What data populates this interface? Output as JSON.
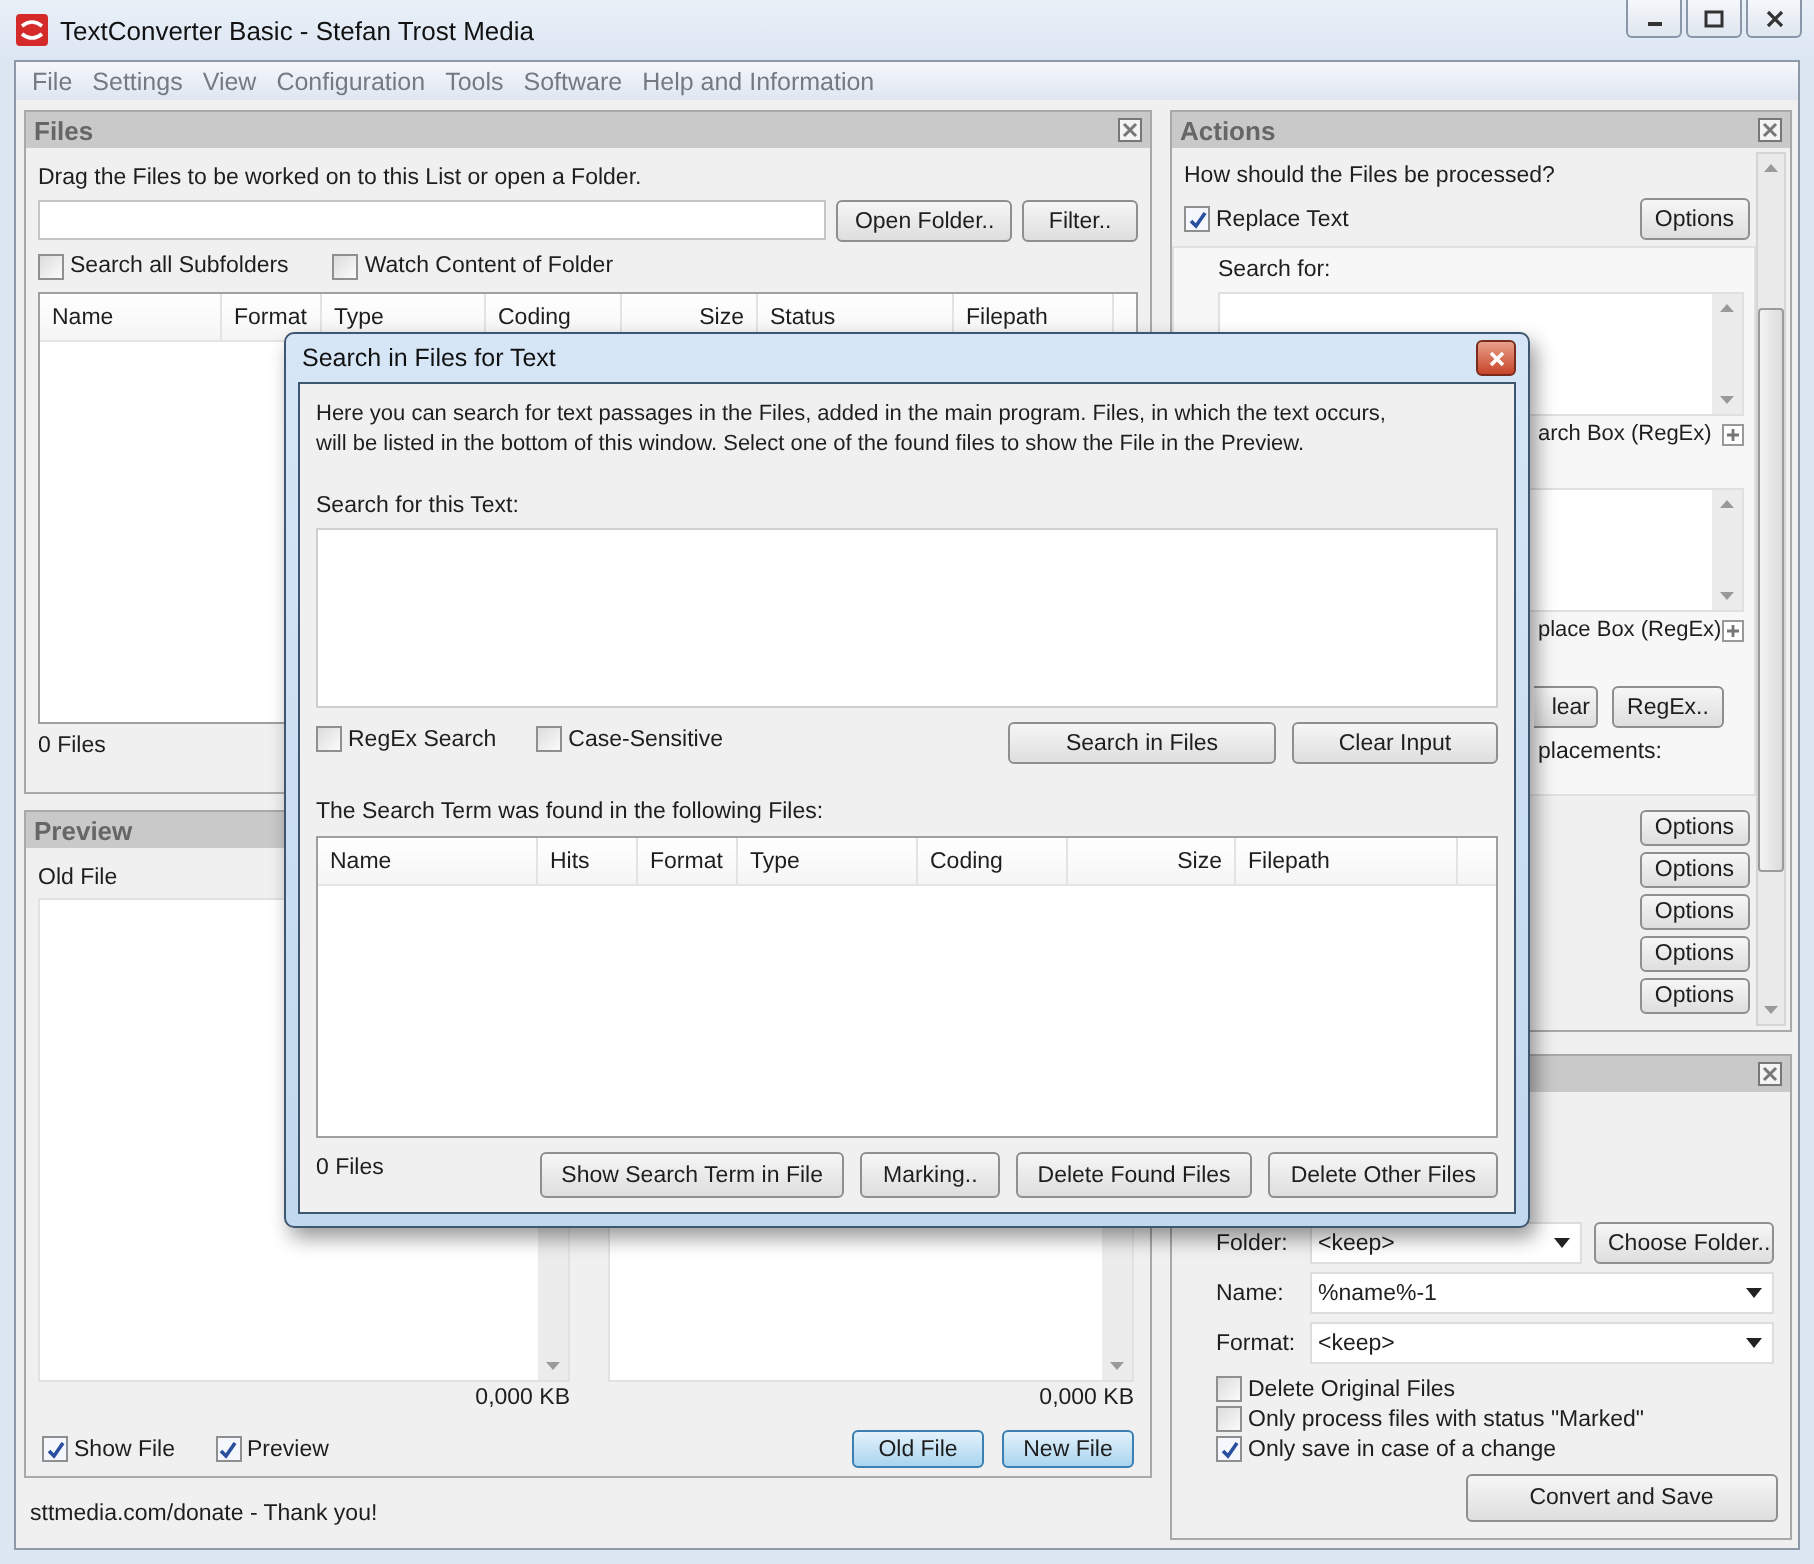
{
  "window": {
    "title": "TextConverter Basic - Stefan Trost Media"
  },
  "menu": [
    "File",
    "Settings",
    "View",
    "Configuration",
    "Tools",
    "Software",
    "Help and Information"
  ],
  "files_panel": {
    "title": "Files",
    "hint": "Drag the Files to be worked on to this List or open a Folder.",
    "buttons": [
      "Open Folder..",
      "Filter.."
    ],
    "options": [
      {
        "label": "Search all Subfolders",
        "checked": false
      },
      {
        "label": "Watch Content of Folder",
        "checked": false
      }
    ],
    "columns": [
      "Name",
      "Format",
      "Type",
      "Coding",
      "Size",
      "Status",
      "Filepath"
    ],
    "count": "0 Files"
  },
  "preview_panel": {
    "title": "Preview",
    "old_label": "Old File",
    "sizes": [
      "0,000 KB",
      "0,000 KB"
    ],
    "options": [
      {
        "label": "Show File",
        "checked": true
      },
      {
        "label": "Preview",
        "checked": true
      }
    ],
    "buttons": [
      "Old File",
      "New File"
    ]
  },
  "status_bar": "sttmedia.com/donate - Thank you!",
  "actions_panel": {
    "title": "Actions",
    "question": "How should the Files be processed?",
    "replace": {
      "label": "Replace Text",
      "checked": true
    },
    "options_button": "Options",
    "search_label": "Search for:",
    "search_box_label": "arch Box (RegEx)",
    "replace_box_label": "place Box (RegEx)",
    "buttons": [
      "lear",
      "RegEx.."
    ],
    "replacements_label": "placements:",
    "option_buttons": [
      "Options",
      "Options",
      "Options",
      "Options",
      "Options"
    ]
  },
  "output_panel": {
    "fields": [
      {
        "label": "Folder:",
        "value": "<keep>"
      },
      {
        "label": "Name:",
        "value": "%name%-1"
      },
      {
        "label": "Format:",
        "value": "<keep>"
      }
    ],
    "choose_button": "Choose Folder..",
    "options": [
      {
        "label": "Delete Original Files",
        "checked": false
      },
      {
        "label": "Only process files with status \"Marked\"",
        "checked": false
      },
      {
        "label": "Only save in case of a change",
        "checked": true
      }
    ],
    "convert_button": "Convert and Save"
  },
  "dialog": {
    "title": "Search in Files for Text",
    "intro": "Here you can search for text passages in the Files, added in the main program. Files, in which the text occurs,\nwill be listed in the bottom of this window. Select one of the found files to show the File in the Preview.",
    "search_label": "Search for this Text:",
    "options": [
      {
        "label": "RegEx Search",
        "checked": false
      },
      {
        "label": "Case-Sensitive",
        "checked": false
      }
    ],
    "buttons": [
      "Search in Files",
      "Clear Input"
    ],
    "results_label": "The Search Term was found in the following Files:",
    "columns": [
      "Name",
      "Hits",
      "Format",
      "Type",
      "Coding",
      "Size",
      "Filepath"
    ],
    "count": "0 Files",
    "actions": [
      "Show Search Term in File",
      "Marking..",
      "Delete Found Files",
      "Delete Other Files"
    ]
  }
}
